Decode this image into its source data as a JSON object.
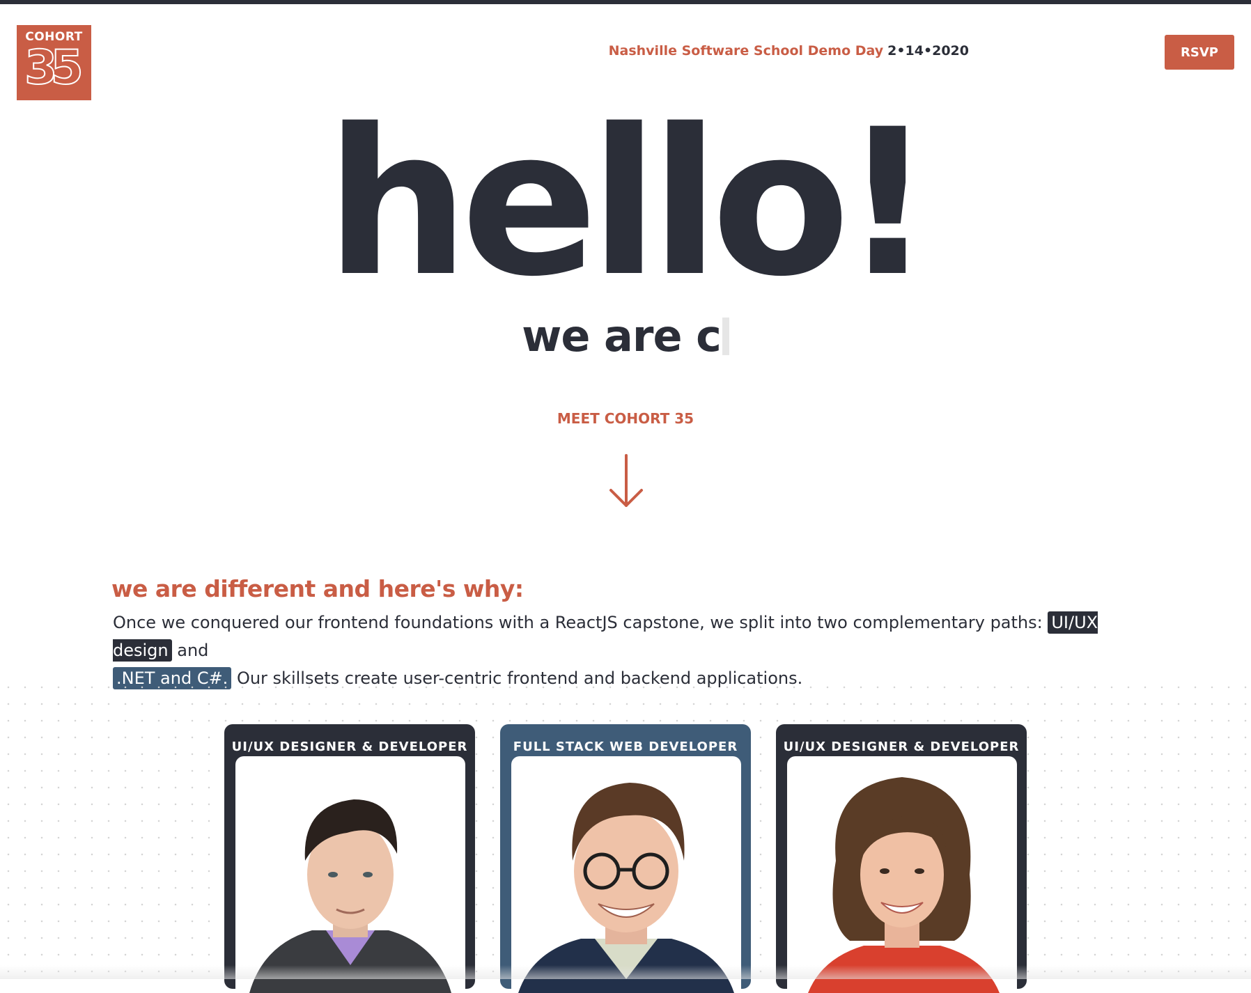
{
  "logo": {
    "top_text": "COHORT",
    "number": "35"
  },
  "header": {
    "school": "Nashville Software School Demo Day",
    "date": "2•14•2020",
    "rsvp_label": "RSVP"
  },
  "hero": {
    "title": "hello!",
    "typed_text": "we are c",
    "meet_label": "MEET COHORT 35"
  },
  "why": {
    "heading": "we are different and here's why:",
    "text_before": "Once we conquered our  frontend foundations  with a ReactJS capstone, we split into two complementary paths: ",
    "tag1": "UI/UX design",
    "text_mid": " and ",
    "tag2": ".NET and C#.",
    "text_after": " Our skillsets create user-centric frontend and backend applications."
  },
  "cards": [
    {
      "role": "UI/UX DESIGNER & DEVELOPER"
    },
    {
      "role": "FULL STACK WEB DEVELOPER"
    },
    {
      "role": "UI/UX DESIGNER & DEVELOPER"
    }
  ],
  "colors": {
    "accent": "#c95d45",
    "dark": "#2b2e38",
    "blue": "#3f5c78"
  },
  "icons": {
    "scroll": "arrow-down-icon"
  }
}
